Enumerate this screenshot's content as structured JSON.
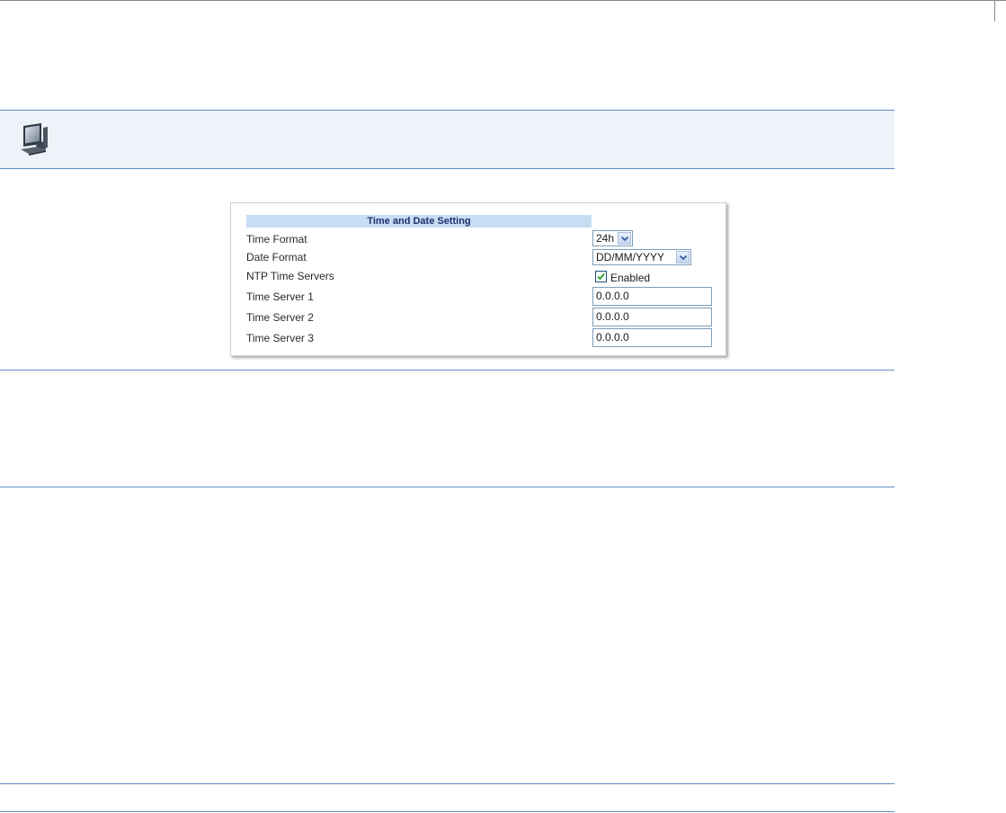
{
  "panel": {
    "title": "Time and Date Setting",
    "rows": {
      "time_format": {
        "label": "Time Format",
        "value": "24h"
      },
      "date_format": {
        "label": "Date Format",
        "value": "DD/MM/YYYY"
      },
      "ntp": {
        "label": "NTP Time Servers",
        "checkbox_label": "Enabled",
        "checked": true
      },
      "server1": {
        "label": "Time Server 1",
        "value": "0.0.0.0"
      },
      "server2": {
        "label": "Time Server 2",
        "value": "0.0.0.0"
      },
      "server3": {
        "label": "Time Server 3",
        "value": "0.0.0.0"
      }
    }
  },
  "icons": {
    "banner": "computer-icon",
    "dropdown": "chevron-down-icon",
    "check": "checkmark-icon"
  },
  "colors": {
    "rule": "#5b8fc7",
    "banner_bg": "#eef3f9",
    "title_bg": "#c7ddf4",
    "title_text": "#1f2f6e"
  }
}
